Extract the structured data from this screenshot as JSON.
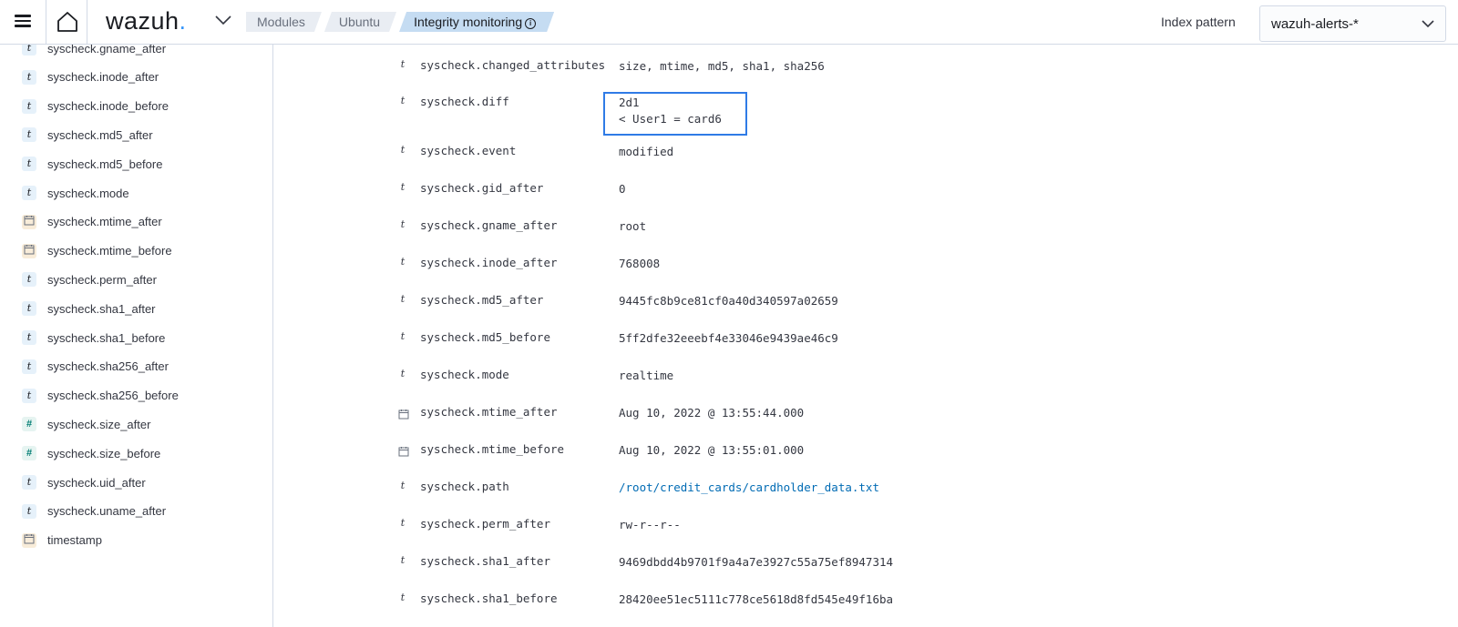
{
  "header": {
    "logo_text": "wazuh",
    "logo_dot": ".",
    "breadcrumbs": [
      {
        "label": "Modules"
      },
      {
        "label": "Ubuntu"
      },
      {
        "label": "Integrity monitoring",
        "info": "i"
      }
    ],
    "index_pattern_label": "Index pattern",
    "index_pattern_value": "wazuh-alerts-*"
  },
  "sidebar": {
    "fields": [
      {
        "type": "t",
        "label": "syscheck.gname_after"
      },
      {
        "type": "t",
        "label": "syscheck.inode_after"
      },
      {
        "type": "t",
        "label": "syscheck.inode_before"
      },
      {
        "type": "t",
        "label": "syscheck.md5_after"
      },
      {
        "type": "t",
        "label": "syscheck.md5_before"
      },
      {
        "type": "t",
        "label": "syscheck.mode"
      },
      {
        "type": "date",
        "label": "syscheck.mtime_after"
      },
      {
        "type": "date",
        "label": "syscheck.mtime_before"
      },
      {
        "type": "t",
        "label": "syscheck.perm_after"
      },
      {
        "type": "t",
        "label": "syscheck.sha1_after"
      },
      {
        "type": "t",
        "label": "syscheck.sha1_before"
      },
      {
        "type": "t",
        "label": "syscheck.sha256_after"
      },
      {
        "type": "t",
        "label": "syscheck.sha256_before"
      },
      {
        "type": "#",
        "label": "syscheck.size_after"
      },
      {
        "type": "#",
        "label": "syscheck.size_before"
      },
      {
        "type": "t",
        "label": "syscheck.uid_after"
      },
      {
        "type": "t",
        "label": "syscheck.uname_after"
      },
      {
        "type": "date",
        "label": "timestamp"
      }
    ]
  },
  "document": {
    "rows": [
      {
        "type": "t",
        "name": "syscheck.changed_attributes",
        "value": "size, mtime, md5, sha1, sha256"
      },
      {
        "type": "t",
        "name": "syscheck.diff",
        "value": "2d1\n< User1 = card6"
      },
      {
        "type": "t",
        "name": "syscheck.event",
        "value": "modified"
      },
      {
        "type": "t",
        "name": "syscheck.gid_after",
        "value": "0"
      },
      {
        "type": "t",
        "name": "syscheck.gname_after",
        "value": "root"
      },
      {
        "type": "t",
        "name": "syscheck.inode_after",
        "value": "768008"
      },
      {
        "type": "t",
        "name": "syscheck.md5_after",
        "value": "9445fc8b9ce81cf0a40d340597a02659"
      },
      {
        "type": "t",
        "name": "syscheck.md5_before",
        "value": "5ff2dfe32eeebf4e33046e9439ae46c9"
      },
      {
        "type": "t",
        "name": "syscheck.mode",
        "value": "realtime"
      },
      {
        "type": "date",
        "name": "syscheck.mtime_after",
        "value": "Aug 10, 2022 @ 13:55:44.000"
      },
      {
        "type": "date",
        "name": "syscheck.mtime_before",
        "value": "Aug 10, 2022 @ 13:55:01.000"
      },
      {
        "type": "t",
        "name": "syscheck.path",
        "value": "/root/credit_cards/cardholder_data.txt",
        "link": true
      },
      {
        "type": "t",
        "name": "syscheck.perm_after",
        "value": "rw-r--r--"
      },
      {
        "type": "t",
        "name": "syscheck.sha1_after",
        "value": "9469dbdd4b9701f9a4a7e3927c55a75ef8947314"
      },
      {
        "type": "t",
        "name": "syscheck.sha1_before",
        "value": "28420ee51ec5111c778ce5618d8fd545e49f16ba"
      }
    ]
  },
  "colors": {
    "accent": "#3595f9",
    "highlight_border": "#2f7be6",
    "link": "#006bb4",
    "active_crumb": "#c5dcf2"
  }
}
